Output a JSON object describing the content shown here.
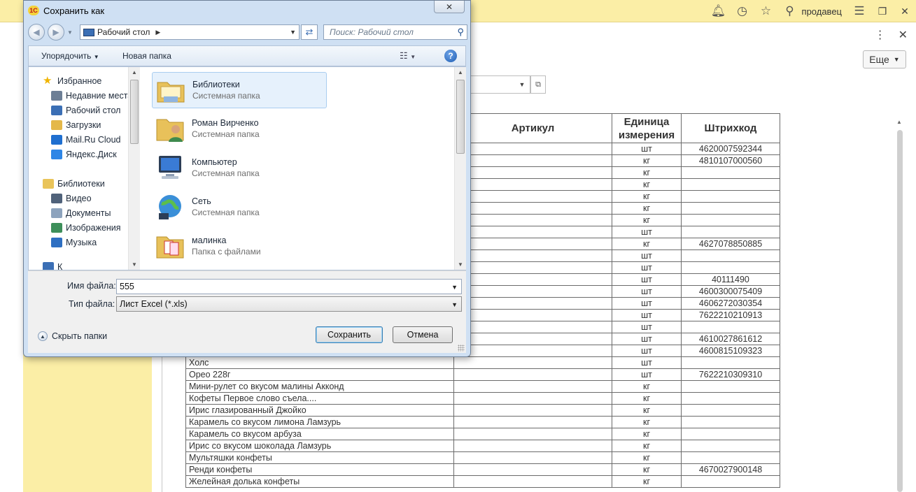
{
  "app": {
    "user": "продавец",
    "more_label": "Еще",
    "icons": [
      "bell-icon",
      "history-icon",
      "star-icon",
      "search-icon",
      "menu-icon",
      "restore-icon",
      "close-icon"
    ]
  },
  "table": {
    "headers": {
      "article": "Артикул",
      "unit_line1": "Единица",
      "unit_line2": "измерения",
      "barcode": "Штрихкод"
    },
    "rows": [
      {
        "name": "",
        "article": "",
        "unit": "шт",
        "barcode": "4620007592344"
      },
      {
        "name": "",
        "article": "",
        "unit": "кг",
        "barcode": "4810107000560"
      },
      {
        "name": "",
        "article": "",
        "unit": "кг",
        "barcode": ""
      },
      {
        "name": "",
        "article": "",
        "unit": "кг",
        "barcode": ""
      },
      {
        "name": "",
        "article": "",
        "unit": "кг",
        "barcode": ""
      },
      {
        "name": "",
        "article": "",
        "unit": "кг",
        "barcode": ""
      },
      {
        "name": "",
        "article": "",
        "unit": "кг",
        "barcode": ""
      },
      {
        "name": "",
        "article": "",
        "unit": "шт",
        "barcode": ""
      },
      {
        "name": "",
        "article": "",
        "unit": "кг",
        "barcode": "4627078850885"
      },
      {
        "name": "",
        "article": "",
        "unit": "шт",
        "barcode": ""
      },
      {
        "name": "",
        "article": "",
        "unit": "шт",
        "barcode": ""
      },
      {
        "name": "",
        "article": "",
        "unit": "шт",
        "barcode": "40111490"
      },
      {
        "name": "",
        "article": "",
        "unit": "шт",
        "barcode": "4600300075409"
      },
      {
        "name": "",
        "article": "",
        "unit": "шт",
        "barcode": "4606272030354"
      },
      {
        "name": "",
        "article": "",
        "unit": "шт",
        "barcode": "7622210210913"
      },
      {
        "name": "",
        "article": "",
        "unit": "шт",
        "barcode": ""
      },
      {
        "name": "",
        "article": "",
        "unit": "шт",
        "barcode": "4610027861612"
      },
      {
        "name": "",
        "article": "",
        "unit": "шт",
        "barcode": "4600815109323"
      },
      {
        "name": "Холс",
        "article": "",
        "unit": "шт",
        "barcode": ""
      },
      {
        "name": "Орео 228г",
        "article": "",
        "unit": "шт",
        "barcode": "7622210309310"
      },
      {
        "name": "Мини-рулет со вкусом малины Акконд",
        "article": "",
        "unit": "кг",
        "barcode": ""
      },
      {
        "name": "Кофеты Первое слово съела....",
        "article": "",
        "unit": "кг",
        "barcode": ""
      },
      {
        "name": "Ирис глазированный Джойко",
        "article": "",
        "unit": "кг",
        "barcode": ""
      },
      {
        "name": "Карамель со вкусом лимона Ламзурь",
        "article": "",
        "unit": "кг",
        "barcode": ""
      },
      {
        "name": "Карамель со вкусом арбуза",
        "article": "",
        "unit": "кг",
        "barcode": ""
      },
      {
        "name": "Ирис со вкусом шоколада Ламзурь",
        "article": "",
        "unit": "кг",
        "barcode": ""
      },
      {
        "name": "Мультяшки  конфеты",
        "article": "",
        "unit": "кг",
        "barcode": ""
      },
      {
        "name": "Ренди конфеты",
        "article": "",
        "unit": "кг",
        "barcode": "4670027900148"
      },
      {
        "name": "Желейная долька конфеты",
        "article": "",
        "unit": "кг",
        "barcode": ""
      }
    ]
  },
  "dialog": {
    "title": "Сохранить как",
    "address": "Рабочий стол",
    "search_placeholder": "Поиск: Рабочий стол",
    "toolbar": {
      "organize": "Упорядочить",
      "new_folder": "Новая папка"
    },
    "tree": [
      {
        "label": "Избранное",
        "icon": "star-icon",
        "color": "#f0b400"
      },
      {
        "label": "Недавние места",
        "icon": "recent-places-icon",
        "color": "#6d7f96"
      },
      {
        "label": "Рабочий стол",
        "icon": "desktop-icon",
        "color": "#3b6fb5"
      },
      {
        "label": "Загрузки",
        "icon": "downloads-icon",
        "color": "#e4b84a"
      },
      {
        "label": "Mail.Ru Cloud",
        "icon": "mailru-cloud-icon",
        "color": "#1f6fd0"
      },
      {
        "label": "Яндекс.Диск",
        "icon": "yandex-disk-icon",
        "color": "#2f86e6"
      },
      {
        "label": "Библиотеки",
        "icon": "libraries-icon",
        "color": "#e9c45a"
      },
      {
        "label": "Видео",
        "icon": "video-icon",
        "color": "#50627a"
      },
      {
        "label": "Документы",
        "icon": "documents-icon",
        "color": "#8da3bd"
      },
      {
        "label": "Изображения",
        "icon": "images-icon",
        "color": "#3d8f5a"
      },
      {
        "label": "Музыка",
        "icon": "music-icon",
        "color": "#2e6fc2"
      },
      {
        "label": "К",
        "icon": "computer-icon",
        "color": "#3b6fb5"
      }
    ],
    "files": [
      {
        "name": "Библиотеки",
        "type": "Системная папка",
        "icon": "libraries-folder-icon",
        "selected": true
      },
      {
        "name": "Роман Вирченко",
        "type": "Системная папка",
        "icon": "user-folder-icon",
        "selected": false
      },
      {
        "name": "Компьютер",
        "type": "Системная папка",
        "icon": "computer-icon",
        "selected": false
      },
      {
        "name": "Сеть",
        "type": "Системная папка",
        "icon": "network-icon",
        "selected": false
      },
      {
        "name": "малинка",
        "type": "Папка с файлами",
        "icon": "folder-icon",
        "selected": false
      }
    ],
    "filename_label": "Имя файла:",
    "filename_value": "555",
    "filetype_label": "Тип файла:",
    "filetype_value": "Лист Excel (*.xls)",
    "hide_folders": "Скрыть папки",
    "save": "Сохранить",
    "cancel": "Отмена"
  }
}
